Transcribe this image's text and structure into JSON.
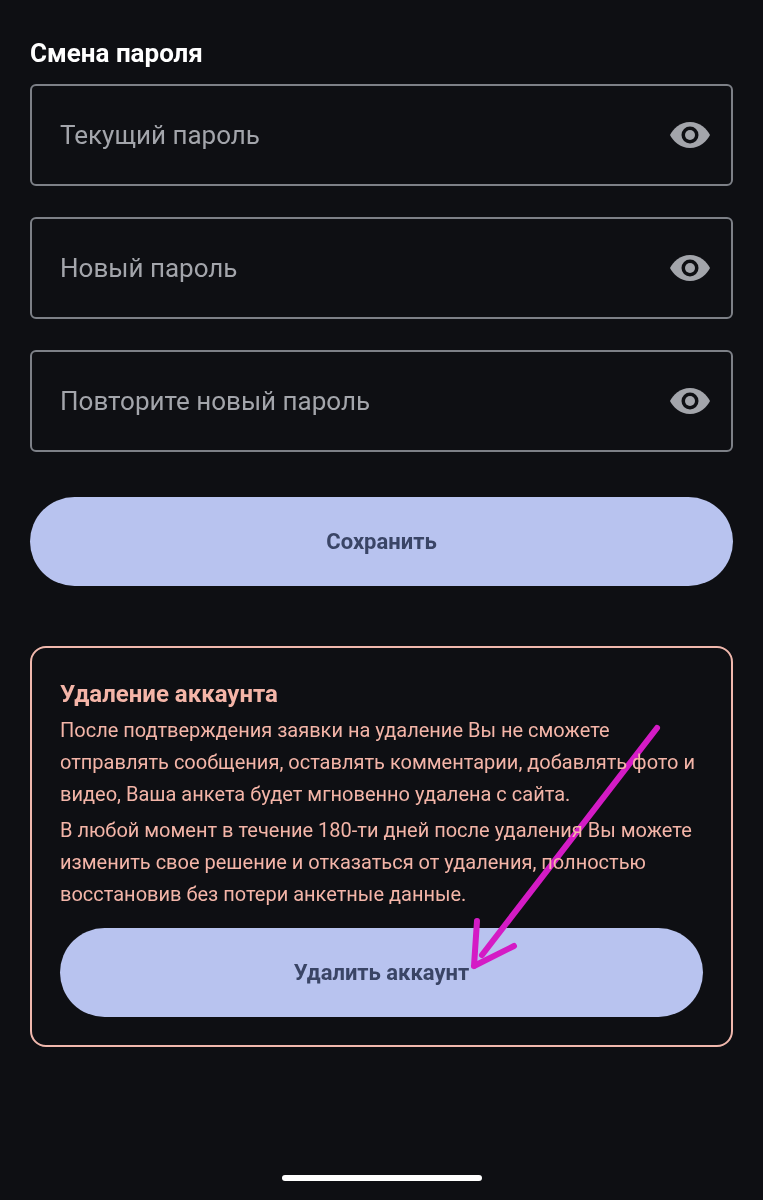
{
  "password_section": {
    "title": "Смена пароля",
    "fields": [
      {
        "placeholder": "Текущий пароль"
      },
      {
        "placeholder": "Новый пароль"
      },
      {
        "placeholder": "Повторите новый пароль"
      }
    ],
    "save_button": "Сохранить"
  },
  "delete_section": {
    "title": "Удаление аккаунта",
    "paragraphs": [
      "После подтверждения заявки на удаление Вы не сможете отправлять сообщения, оставлять комментарии, добавлять фото и видео, Ваша анкета будет мгновенно удалена с сайта.",
      "В любой момент в течение 180-ти дней после удаления Вы можете изменить свое решение и отказаться от удаления, полностью восстановив без потери анкетные данные."
    ],
    "button": "Удалить аккаунт"
  }
}
